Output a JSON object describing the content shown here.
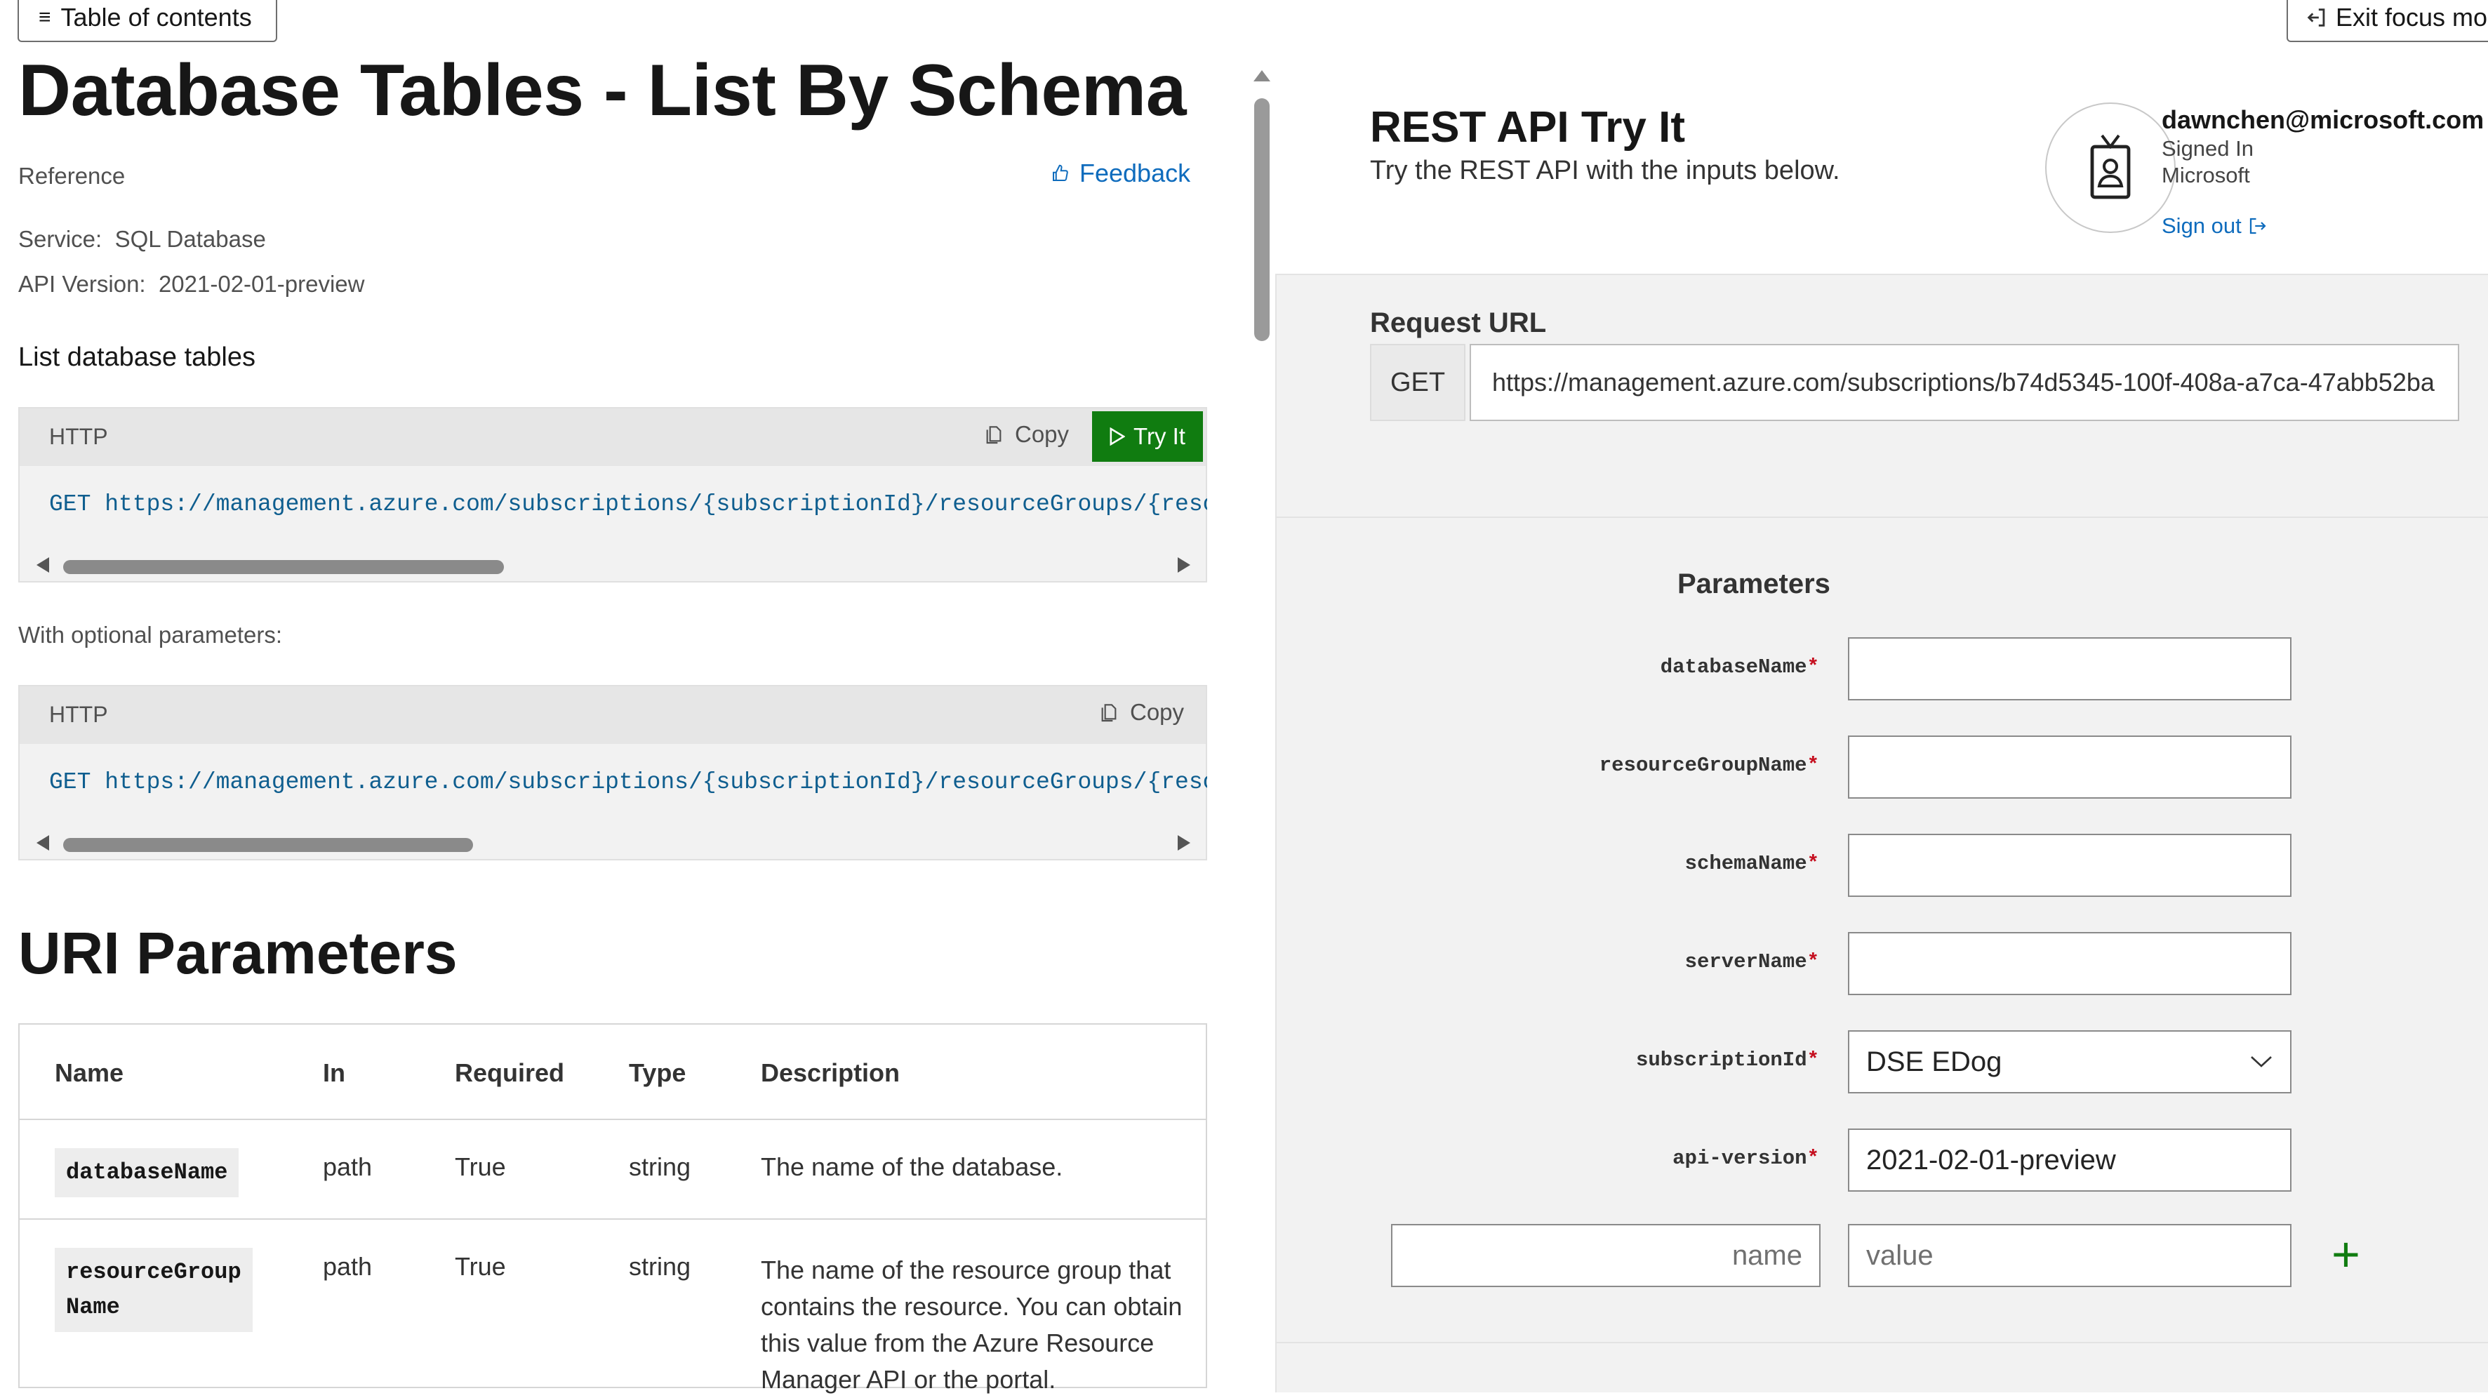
{
  "topbar": {
    "toc_label": "Table of contents",
    "exit_label": "Exit focus mo"
  },
  "doc": {
    "title": "Database Tables - List By Schema",
    "reference": "Reference",
    "feedback": "Feedback",
    "service_label": "Service:",
    "service_value": "SQL Database",
    "api_version_label": "API Version:",
    "api_version_value": "2021-02-01-preview",
    "intro": "List database tables",
    "optional_params": "With optional parameters:",
    "code_blocks": [
      {
        "lang": "HTTP",
        "copy": "Copy",
        "tryit": "Try It",
        "code": "GET https://management.azure.com/subscriptions/{subscriptionId}/resourceGroups/{resour"
      },
      {
        "lang": "HTTP",
        "copy": "Copy",
        "code": "GET https://management.azure.com/subscriptions/{subscriptionId}/resourceGroups/{resour"
      }
    ],
    "uri_title": "URI Parameters",
    "table": {
      "headers": [
        "Name",
        "In",
        "Required",
        "Type",
        "Description"
      ],
      "rows": [
        {
          "name": "databaseName",
          "in": "path",
          "required": "True",
          "type": "string",
          "description": "The name of the database."
        },
        {
          "name_line1": "resourceGroup",
          "name_line2": "Name",
          "in": "path",
          "required": "True",
          "type": "string",
          "desc_line1": "The name of the resource group that",
          "desc_line2": "contains the resource. You can obtain",
          "desc_line3": "this value from the Azure Resource",
          "desc_line4": "Manager API or the portal."
        }
      ]
    }
  },
  "tryit": {
    "title": "REST API Try It",
    "subtitle": "Try the REST API with the inputs below.",
    "user": {
      "email": "dawnchen@microsoft.com",
      "status": "Signed In",
      "org": "Microsoft",
      "signout": "Sign out"
    },
    "request_label": "Request URL",
    "method": "GET",
    "url": "https://management.azure.com/subscriptions/b74d5345-100f-408a-a7ca-47abb52ba",
    "params_title": "Parameters",
    "params": [
      {
        "label": "databaseName",
        "value": ""
      },
      {
        "label": "resourceGroupName",
        "value": ""
      },
      {
        "label": "schemaName",
        "value": ""
      },
      {
        "label": "serverName",
        "value": ""
      },
      {
        "label": "subscriptionId",
        "value": "DSE EDog"
      },
      {
        "label": "api-version",
        "value": "2021-02-01-preview"
      }
    ],
    "custom_param": {
      "name_placeholder": "name",
      "value_placeholder": "value"
    },
    "required_mark": "*"
  },
  "colors": {
    "accent_link": "#0f6cbd",
    "tryit_green": "#107c10",
    "required_red": "#c50f1f"
  },
  "icons": [
    "hamburger-icon",
    "exit-icon",
    "feedback-icon",
    "copy-icon",
    "play-icon",
    "badge-icon",
    "signout-icon",
    "chevron-down-icon",
    "plus-icon"
  ]
}
